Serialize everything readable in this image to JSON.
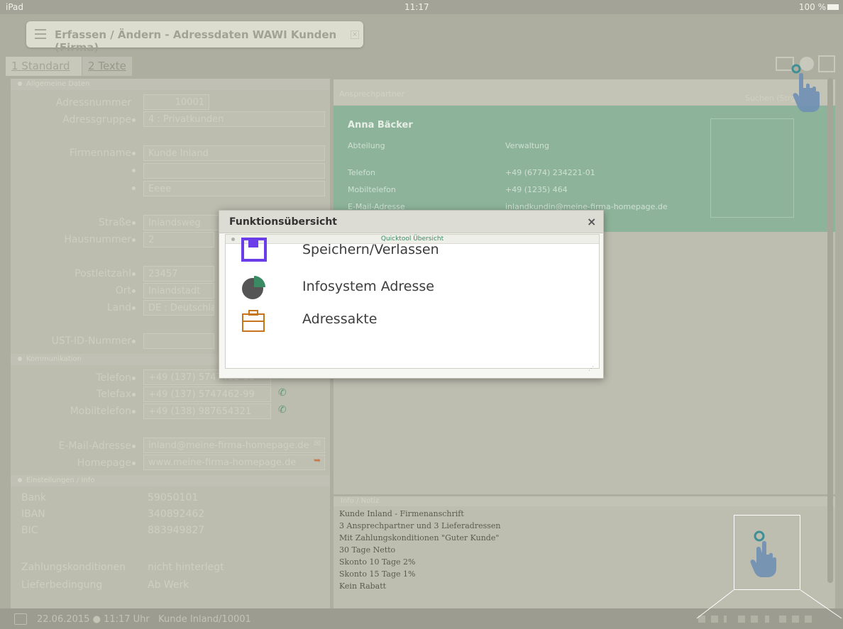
{
  "statusbar": {
    "device": "iPad",
    "time": "11:17",
    "battery": "100 %"
  },
  "window": {
    "title": "Erfassen / Ändern - Adressdaten WAWI Kunden (Firma)",
    "close": "×"
  },
  "tabs": [
    {
      "num": "1",
      "label": "Standard"
    },
    {
      "num": "2",
      "label": "Texte"
    }
  ],
  "general": {
    "section": "Allgemeine Daten",
    "adressnummer_label": "Adressnummer",
    "adressnummer": "10001",
    "adressgruppe_label": "Adressgruppe",
    "adressgruppe": "4   : Privatkunden",
    "firmenname_label": "Firmenname",
    "firmenname": "Kunde Inland",
    "firmenname2": "",
    "firmenname3": "Eeee",
    "strasse_label": "Straße",
    "strasse": "Inlandsweg",
    "hausnummer_label": "Hausnummer",
    "hausnummer": "2",
    "plz_label": "Postleitzahl",
    "plz": "23457",
    "ort_label": "Ort",
    "ort": "Inlandstadt",
    "land_label": "Land",
    "land": "DE   : Deutschla",
    "ust_label": "UST-ID-Nummer",
    "ust": ""
  },
  "communication": {
    "section": "Kommunikation",
    "telefon_label": "Telefon",
    "telefon": "+49 (137) 5747462-00",
    "telefax_label": "Telefax",
    "telefax": "+49 (137) 5747462-99",
    "mobil_label": "Mobiltelefon",
    "mobil": "+49 (138) 987654321",
    "email_label": "E-Mail-Adresse",
    "email": "inland@meine-firma-homepage.de",
    "homepage_label": "Homepage",
    "homepage": "www.meine-firma-homepage.de"
  },
  "settings": {
    "section": "Einstellungen / Info",
    "bank_label": "Bank",
    "bank": "59050101",
    "iban_label": "IBAN",
    "iban": "340892462",
    "bic_label": "BIC",
    "bic": "883949827",
    "zahlung_label": "Zahlungskonditionen",
    "zahlung": "nicht hinterlegt",
    "liefer_label": "Lieferbedingung",
    "liefer": "Ab Werk"
  },
  "contact": {
    "section": "Ansprechpartner",
    "search_placeholder": "Suchen (Strg",
    "name": "Anna Bäcker",
    "abteilung_label": "Abteilung",
    "abteilung": "Verwaltung",
    "telefon_label": "Telefon",
    "telefon": "+49 (6774) 234221-01",
    "mobil_label": "Mobiltelefon",
    "mobil": "+49 (1235) 464",
    "email_label": "E-Mail-Adresse",
    "email": "inlandkundin@meine-firma-homepage.de"
  },
  "notes": {
    "section": "Info / Notiz",
    "lines": [
      "Kunde Inland - Firmenanschrift",
      "3 Ansprechpartner und 3 Lieferadressen",
      "Mit Zahlungskonditionen \"Guter Kunde\"",
      "30 Tage Netto",
      "Skonto 10 Tage 2%",
      "Skonto 15 Tage 1%",
      "Kein Rabatt"
    ]
  },
  "dialog": {
    "title": "Funktionsübersicht",
    "close": "×",
    "subheader": "Quicktool Übersicht",
    "items": [
      {
        "label": "Speichern/Verlassen",
        "icon": "save-icon",
        "color": "#6a3de8"
      },
      {
        "label": "Infosystem Adresse",
        "icon": "pie-chart-icon",
        "color": "#3a8a64"
      },
      {
        "label": "Adressakte",
        "icon": "briefcase-icon",
        "color": "#c7751d"
      }
    ]
  },
  "bottombar": {
    "date": "22.06.2015",
    "time": "11:17 Uhr",
    "record": "Kunde Inland/10001"
  }
}
